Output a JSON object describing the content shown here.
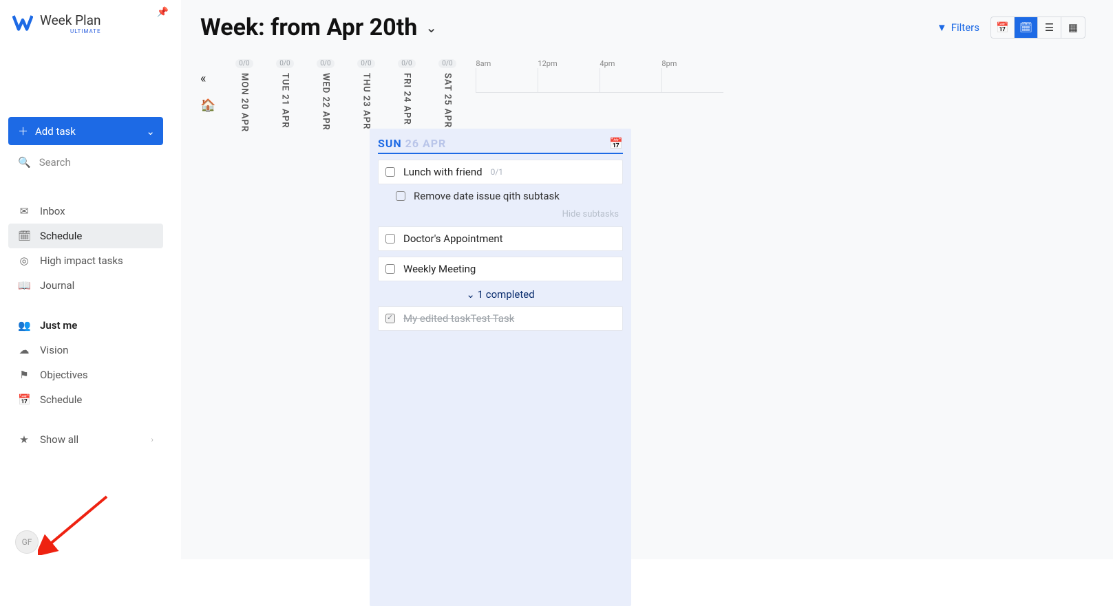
{
  "app": {
    "name": "Week Plan",
    "tier": "ULTIMATE"
  },
  "sidebar": {
    "add_task": "Add task",
    "search": "Search",
    "nav": [
      {
        "icon": "inbox",
        "label": "Inbox"
      },
      {
        "icon": "calendar-check",
        "label": "Schedule",
        "active": true
      },
      {
        "icon": "target",
        "label": "High impact tasks"
      },
      {
        "icon": "book",
        "label": "Journal"
      }
    ],
    "me_section": [
      {
        "icon": "users",
        "label": "Just me",
        "bold": true
      },
      {
        "icon": "cloud",
        "label": "Vision"
      },
      {
        "icon": "flag",
        "label": "Objectives"
      },
      {
        "icon": "calendar",
        "label": "Schedule"
      }
    ],
    "show_all": "Show all",
    "avatar": "GF"
  },
  "header": {
    "title": "Week: from Apr 20th",
    "filters": "Filters"
  },
  "timeline": {
    "ticks": [
      "8am",
      "12pm",
      "4pm",
      "8pm"
    ]
  },
  "week_days": [
    {
      "badge": "0/0",
      "label": "MON 20 APR"
    },
    {
      "badge": "0/0",
      "label": "TUE 21 APR"
    },
    {
      "badge": "0/0",
      "label": "WED 22 APR"
    },
    {
      "badge": "0/0",
      "label": "THU 23 APR"
    },
    {
      "badge": "0/0",
      "label": "FRI 24 APR"
    },
    {
      "badge": "0/0",
      "label": "SAT 25 APR"
    }
  ],
  "panel": {
    "day": "SUN",
    "date": "26 APR",
    "tasks": [
      {
        "title": "Lunch with friend",
        "meta": "0/1"
      },
      {
        "title": "Doctor's Appointment"
      },
      {
        "title": "Weekly Meeting"
      }
    ],
    "subtask": "Remove date issue qith subtask",
    "hide": "Hide subtasks",
    "completed_label": "1 completed",
    "completed_task": "My edited taskTest Task"
  }
}
